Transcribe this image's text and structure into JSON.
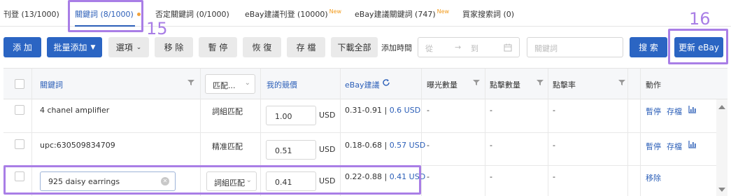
{
  "tabs": [
    {
      "label": "刊登 (13/1000)",
      "new": ""
    },
    {
      "label": "關鍵詞 (8/1000)",
      "new": ""
    },
    {
      "label": "否定關鍵詞 (0/1000)",
      "new": ""
    },
    {
      "label": "eBay建議刊登 (10000)",
      "new": "New"
    },
    {
      "label": "eBay建議關鍵詞 (747)",
      "new": "New"
    },
    {
      "label": "買家搜索詞 (0)",
      "new": ""
    }
  ],
  "annotations": {
    "a15": "15",
    "a16": "16"
  },
  "toolbar": {
    "add": "添 加",
    "bulk_add": "批量添加",
    "options": "選項",
    "remove": "移 除",
    "pause": "暫 停",
    "resume": "恢 復",
    "archive": "存 檔",
    "download_all": "下載全部",
    "added_time": "添加時間",
    "date_from": "從",
    "date_to": "到",
    "keyword_placeholder": "關鍵詞",
    "search": "搜 索",
    "update_ebay": "更新 eBay"
  },
  "table": {
    "headers": {
      "keyword": "關鍵詞",
      "match": "匹配...",
      "my_bid": "我的競價",
      "ebay_suggest": "eBay建議",
      "impressions": "曝光數量",
      "clicks": "點擊數量",
      "ctr": "點擊率",
      "action": "動作"
    },
    "rows": [
      {
        "keyword": "4 chanel amplifier",
        "match": "詞組匹配",
        "bid": "1.00",
        "currency": "USD",
        "range": "0.31-0.91",
        "sep": "|",
        "suggest": "0.6 USD",
        "imp": "-",
        "clk": "-",
        "ctr": "-",
        "a1": "暫停",
        "a2": "存檔"
      },
      {
        "keyword": "upc:630509834709",
        "match": "精准匹配",
        "bid": "0.51",
        "currency": "USD",
        "range": "0.18-0.68",
        "sep": "|",
        "suggest": "0.57 USD",
        "imp": "-",
        "clk": "-",
        "ctr": "-",
        "a1": "暫停",
        "a2": "存檔"
      },
      {
        "keyword": "925 daisy earrings",
        "match": "詞組匹配",
        "bid": "0.41",
        "currency": "USD",
        "range": "0.22-0.88",
        "sep": "|",
        "suggest": "0.41 USD",
        "imp": "-",
        "clk": "-",
        "ctr": "-",
        "a1": "移除",
        "a2": ""
      }
    ]
  }
}
